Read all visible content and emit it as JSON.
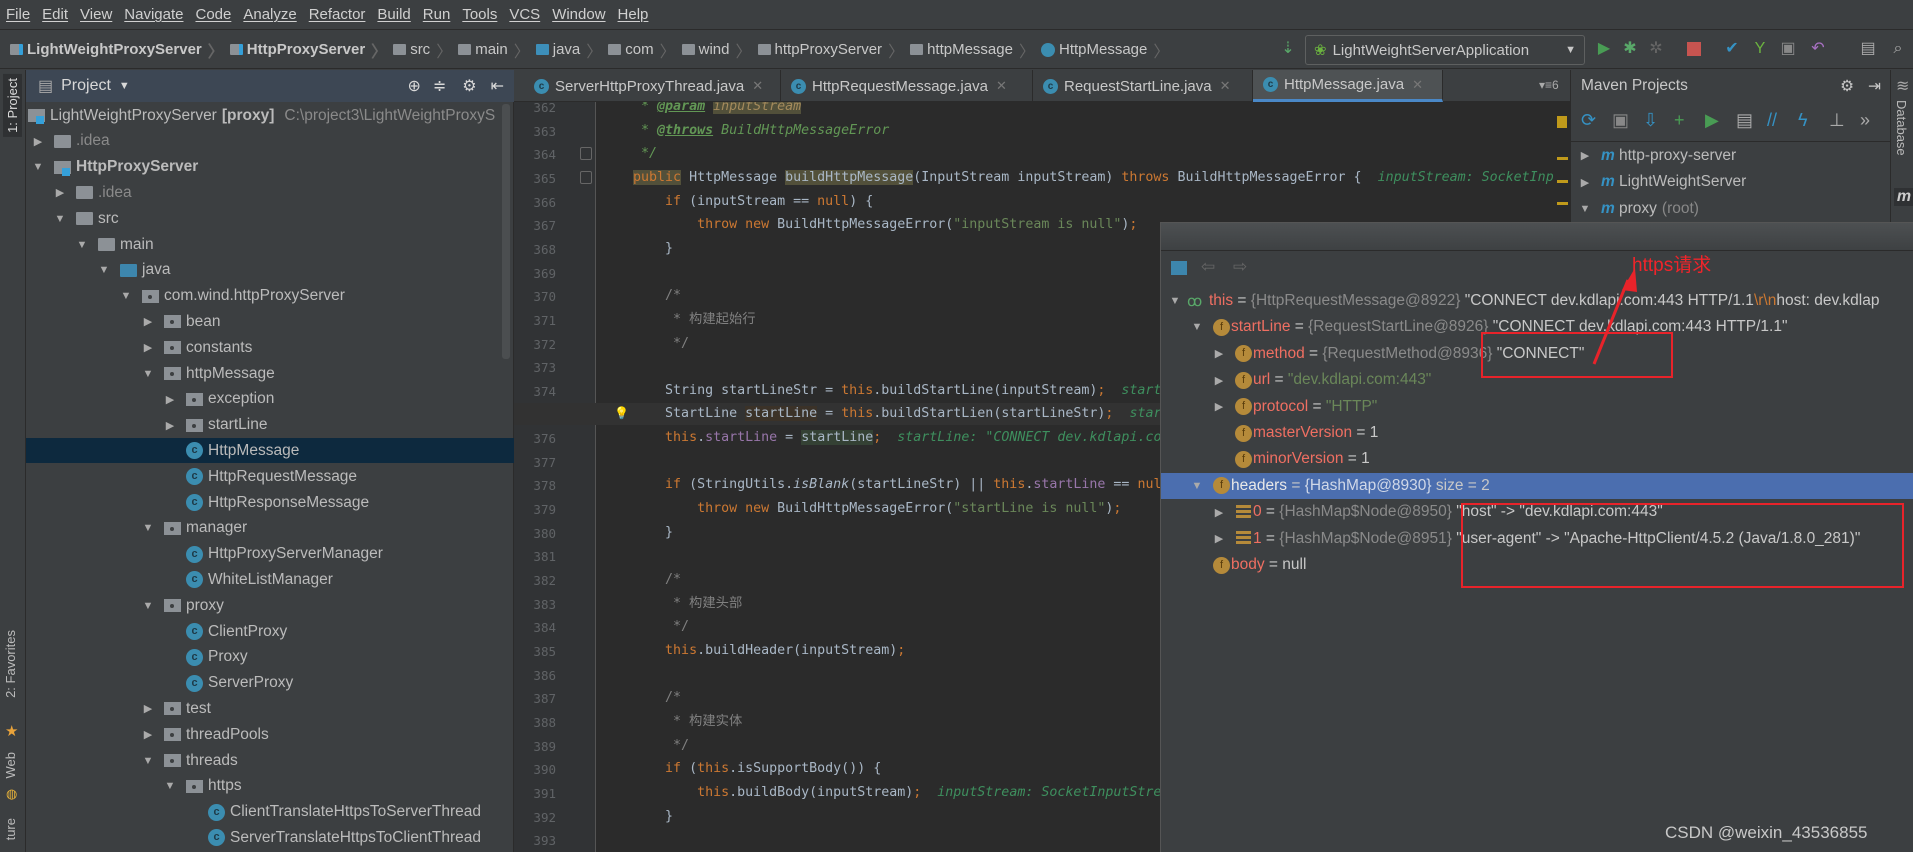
{
  "menu": [
    "File",
    "Edit",
    "View",
    "Navigate",
    "Code",
    "Analyze",
    "Refactor",
    "Build",
    "Run",
    "Tools",
    "VCS",
    "Window",
    "Help"
  ],
  "breadcrumbs": [
    {
      "label": "LightWeightProxyServer",
      "icon": "module-icon",
      "bold": true
    },
    {
      "label": "HttpProxyServer",
      "icon": "module-icon",
      "bold": true
    },
    {
      "label": "src",
      "icon": "folder-icon"
    },
    {
      "label": "main",
      "icon": "folder-icon"
    },
    {
      "label": "java",
      "icon": "source-folder-icon"
    },
    {
      "label": "com",
      "icon": "package-icon"
    },
    {
      "label": "wind",
      "icon": "package-icon"
    },
    {
      "label": "httpProxyServer",
      "icon": "package-icon"
    },
    {
      "label": "httpMessage",
      "icon": "package-icon"
    },
    {
      "label": "HttpMessage",
      "icon": "class-icon"
    }
  ],
  "run_config": "LightWeightServerApplication",
  "left_stripe": {
    "project": "1: Project",
    "favorites": "2: Favorites",
    "web": "Web",
    "structure": "ture"
  },
  "project_panel": {
    "title": "Project",
    "items": [
      {
        "depth": 0,
        "arrow": "",
        "icon": "module",
        "label": "LightWeightProxyServer",
        "suffix": "[proxy]",
        "path": "C:\\project3\\LightWeightProxyS"
      },
      {
        "depth": 0,
        "arrow": "right",
        "icon": "folder",
        "label": ".idea",
        "gray": true
      },
      {
        "depth": 0,
        "arrow": "down",
        "icon": "module",
        "label": "HttpProxyServer",
        "bold": true
      },
      {
        "depth": 1,
        "arrow": "right",
        "icon": "folder",
        "label": ".idea",
        "gray": true
      },
      {
        "depth": 1,
        "arrow": "down",
        "icon": "folder",
        "label": "src"
      },
      {
        "depth": 2,
        "arrow": "down",
        "icon": "folder",
        "label": "main"
      },
      {
        "depth": 3,
        "arrow": "down",
        "icon": "java",
        "label": "java"
      },
      {
        "depth": 4,
        "arrow": "down",
        "icon": "pkg",
        "label": "com.wind.httpProxyServer"
      },
      {
        "depth": 5,
        "arrow": "right",
        "icon": "pkg",
        "label": "bean"
      },
      {
        "depth": 5,
        "arrow": "right",
        "icon": "pkg",
        "label": "constants"
      },
      {
        "depth": 5,
        "arrow": "down",
        "icon": "pkg",
        "label": "httpMessage"
      },
      {
        "depth": 6,
        "arrow": "right",
        "icon": "pkg",
        "label": "exception"
      },
      {
        "depth": 6,
        "arrow": "right",
        "icon": "pkg",
        "label": "startLine"
      },
      {
        "depth": 6,
        "arrow": "",
        "icon": "cls",
        "label": "HttpMessage",
        "selected": true
      },
      {
        "depth": 6,
        "arrow": "",
        "icon": "cls",
        "label": "HttpRequestMessage"
      },
      {
        "depth": 6,
        "arrow": "",
        "icon": "cls",
        "label": "HttpResponseMessage"
      },
      {
        "depth": 5,
        "arrow": "down",
        "icon": "pkg",
        "label": "manager"
      },
      {
        "depth": 6,
        "arrow": "",
        "icon": "cls",
        "label": "HttpProxyServerManager"
      },
      {
        "depth": 6,
        "arrow": "",
        "icon": "cls",
        "label": "WhiteListManager"
      },
      {
        "depth": 5,
        "arrow": "down",
        "icon": "pkg",
        "label": "proxy"
      },
      {
        "depth": 6,
        "arrow": "",
        "icon": "cls",
        "label": "ClientProxy"
      },
      {
        "depth": 6,
        "arrow": "",
        "icon": "cls",
        "label": "Proxy"
      },
      {
        "depth": 6,
        "arrow": "",
        "icon": "cls",
        "label": "ServerProxy"
      },
      {
        "depth": 5,
        "arrow": "right",
        "icon": "pkg",
        "label": "test"
      },
      {
        "depth": 5,
        "arrow": "right",
        "icon": "pkg",
        "label": "threadPools"
      },
      {
        "depth": 5,
        "arrow": "down",
        "icon": "pkg",
        "label": "threads"
      },
      {
        "depth": 6,
        "arrow": "down",
        "icon": "pkg",
        "label": "https"
      },
      {
        "depth": 7,
        "arrow": "",
        "icon": "cls",
        "label": "ClientTranslateHttpsToServerThread"
      },
      {
        "depth": 7,
        "arrow": "",
        "icon": "cls",
        "label": "ServerTranslateHttpsToClientThread"
      }
    ]
  },
  "tabs": [
    {
      "label": "ServerHttpProxyThread.java"
    },
    {
      "label": "HttpRequestMessage.java"
    },
    {
      "label": "RequestStartLine.java"
    },
    {
      "label": "HttpMessage.java",
      "active": true
    }
  ],
  "tab_overflow_count": "6",
  "editor": {
    "current_line": 375,
    "lines": [
      {
        "n": "362",
        "t": [
          [
            "     * ",
            "cmi"
          ],
          [
            "@param",
            "tag"
          ],
          [
            " ",
            "cmi"
          ],
          [
            "inputStream",
            "mark"
          ]
        ]
      },
      {
        "n": "363",
        "t": [
          [
            "     * ",
            "cmi"
          ],
          [
            "@throws",
            "tag"
          ],
          [
            " BuildHttpMessageError",
            "cmi"
          ]
        ]
      },
      {
        "n": "364",
        "t": [
          [
            "     */",
            "cmi"
          ]
        ]
      },
      {
        "n": "365",
        "t": [
          [
            "    "
          ],
          [
            "public",
            "k hl"
          ],
          [
            " HttpMessage "
          ],
          [
            "buildHttpMessage",
            "hl"
          ],
          [
            "(InputStream inputStream) "
          ],
          [
            "throws",
            "k"
          ],
          [
            " BuildHttpMessageError {  "
          ],
          [
            "inputStream: SocketInp",
            "hint"
          ]
        ]
      },
      {
        "n": "366",
        "t": [
          [
            "        "
          ],
          [
            "if",
            "k"
          ],
          [
            " (inputStream == "
          ],
          [
            "null",
            "k"
          ],
          [
            ") {"
          ]
        ]
      },
      {
        "n": "367",
        "t": [
          [
            "            "
          ],
          [
            "throw new",
            "k"
          ],
          [
            " BuildHttpMessageError("
          ],
          [
            "\"inputStream is null\"",
            "s"
          ],
          [
            ")"
          ],
          [
            ";",
            "k"
          ]
        ]
      },
      {
        "n": "368",
        "t": [
          [
            "        }"
          ]
        ]
      },
      {
        "n": "369",
        "t": []
      },
      {
        "n": "370",
        "t": [
          [
            "        /*",
            "cm"
          ]
        ]
      },
      {
        "n": "371",
        "t": [
          [
            "         * 构建起始行",
            "cm"
          ]
        ]
      },
      {
        "n": "372",
        "t": [
          [
            "         */",
            "cm"
          ]
        ]
      },
      {
        "n": "373",
        "t": []
      },
      {
        "n": "374",
        "t": [
          [
            "        String startLineStr = "
          ],
          [
            "this",
            "k"
          ],
          [
            ".buildStartLine(inputStream)"
          ],
          [
            ";",
            "k"
          ],
          [
            "  "
          ],
          [
            "start",
            "hint"
          ]
        ]
      },
      {
        "n": "375",
        "t": [
          [
            "        StartLine "
          ],
          [
            "startLine",
            "hlv"
          ],
          [
            " = "
          ],
          [
            "this",
            "k"
          ],
          [
            ".buildStartLien(startLineStr)"
          ],
          [
            ";",
            "k"
          ],
          [
            "  "
          ],
          [
            "star",
            "hint"
          ]
        ]
      },
      {
        "n": "376",
        "t": [
          [
            "        "
          ],
          [
            "this",
            "k"
          ],
          [
            "."
          ],
          [
            "startLine",
            "f"
          ],
          [
            " = "
          ],
          [
            "startLine",
            "hlp"
          ],
          [
            ";",
            "k"
          ],
          [
            "  "
          ],
          [
            "startLine: \"CONNECT dev.kdlapi.co",
            "hint"
          ]
        ]
      },
      {
        "n": "377",
        "t": []
      },
      {
        "n": "378",
        "t": [
          [
            "        "
          ],
          [
            "if",
            "k"
          ],
          [
            " (StringUtils."
          ],
          [
            "isBlank",
            "it"
          ],
          [
            "(startLineStr) || "
          ],
          [
            "this",
            "k"
          ],
          [
            "."
          ],
          [
            "startLine",
            "f"
          ],
          [
            " == "
          ],
          [
            "nul",
            "k"
          ]
        ]
      },
      {
        "n": "379",
        "t": [
          [
            "            "
          ],
          [
            "throw new",
            "k"
          ],
          [
            " BuildHttpMessageError("
          ],
          [
            "\"startLine is null\"",
            "s"
          ],
          [
            ")"
          ],
          [
            ";",
            "k"
          ]
        ]
      },
      {
        "n": "380",
        "t": [
          [
            "        }"
          ]
        ]
      },
      {
        "n": "381",
        "t": []
      },
      {
        "n": "382",
        "t": [
          [
            "        /*",
            "cm"
          ]
        ]
      },
      {
        "n": "383",
        "t": [
          [
            "         * 构建头部",
            "cm"
          ]
        ]
      },
      {
        "n": "384",
        "t": [
          [
            "         */",
            "cm"
          ]
        ]
      },
      {
        "n": "385",
        "t": [
          [
            "        "
          ],
          [
            "this",
            "k"
          ],
          [
            ".buildHeader(inputStream)"
          ],
          [
            ";",
            "k"
          ]
        ]
      },
      {
        "n": "386",
        "t": []
      },
      {
        "n": "387",
        "t": [
          [
            "        /*",
            "cm"
          ]
        ]
      },
      {
        "n": "388",
        "t": [
          [
            "         * 构建实体",
            "cm"
          ]
        ]
      },
      {
        "n": "389",
        "t": [
          [
            "         */",
            "cm"
          ]
        ]
      },
      {
        "n": "390",
        "t": [
          [
            "        "
          ],
          [
            "if",
            "k"
          ],
          [
            " ("
          ],
          [
            "this",
            "k"
          ],
          [
            ".isSupportBody()) {"
          ]
        ]
      },
      {
        "n": "391",
        "t": [
          [
            "            "
          ],
          [
            "this",
            "k"
          ],
          [
            ".buildBody(inputStream)"
          ],
          [
            ";",
            "k"
          ],
          [
            "  "
          ],
          [
            "inputStream: SocketInputStre",
            "hint"
          ]
        ]
      },
      {
        "n": "392",
        "t": [
          [
            "        }"
          ]
        ]
      },
      {
        "n": "393",
        "t": []
      }
    ]
  },
  "maven": {
    "title": "Maven Projects",
    "toolbar": [
      "reimport-icon",
      "generate-sources-icon",
      "download-icon",
      "add-icon",
      "run-icon",
      "execute-goal-icon",
      "toggle-offline-icon",
      "skip-tests-icon",
      "show-dependencies-icon",
      "more-icon"
    ],
    "items": [
      {
        "label": "http-proxy-server",
        "arrow": "right"
      },
      {
        "label": "LightWeightServer",
        "arrow": "right"
      },
      {
        "label": "proxy",
        "suffix": "(root)",
        "arrow": "down"
      }
    ]
  },
  "right_stripe": {
    "database": "Database",
    "maven": "m"
  },
  "debug_popup": {
    "rows": [
      {
        "depth": 0,
        "arrow": "down",
        "icon": "watch",
        "t": [
          [
            "this",
            "dn"
          ],
          [
            " = ",
            "dv"
          ],
          [
            "{HttpRequestMessage@8922}",
            "dt"
          ],
          [
            " \"CONNECT dev.kdlapi.com:443 HTTP/1.1",
            "dv"
          ],
          [
            "\\r\\n",
            "de"
          ],
          [
            "host: dev.kdlap",
            "dv"
          ]
        ]
      },
      {
        "depth": 1,
        "arrow": "down",
        "icon": "f",
        "t": [
          [
            "startLine",
            "dn"
          ],
          [
            " = ",
            "dv"
          ],
          [
            "{RequestStartLine@8926}",
            "dt"
          ],
          [
            " \"CONNECT dev.kdlapi.com:443 HTTP/1.1\"",
            "dv"
          ]
        ]
      },
      {
        "depth": 2,
        "arrow": "right",
        "icon": "f",
        "t": [
          [
            "method",
            "dn"
          ],
          [
            " = ",
            "dv"
          ],
          [
            "{RequestMethod@8936}",
            "dt"
          ],
          [
            " \"CONNECT\"",
            "dv"
          ]
        ]
      },
      {
        "depth": 2,
        "arrow": "right",
        "icon": "f",
        "t": [
          [
            "url",
            "dn"
          ],
          [
            " = ",
            "dv"
          ],
          [
            "\"dev.kdlapi.com:443\"",
            "ds"
          ]
        ]
      },
      {
        "depth": 2,
        "arrow": "right",
        "icon": "f",
        "t": [
          [
            "protocol",
            "dn"
          ],
          [
            " = ",
            "dv"
          ],
          [
            "\"HTTP\"",
            "ds"
          ]
        ]
      },
      {
        "depth": 2,
        "arrow": "",
        "icon": "f",
        "t": [
          [
            "masterVersion",
            "dn"
          ],
          [
            " = 1",
            "dv"
          ]
        ]
      },
      {
        "depth": 2,
        "arrow": "",
        "icon": "f",
        "t": [
          [
            "minorVersion",
            "dn"
          ],
          [
            " = 1",
            "dv"
          ]
        ]
      },
      {
        "depth": 1,
        "arrow": "down",
        "icon": "f",
        "selected": true,
        "t": [
          [
            "headers",
            "dn"
          ],
          [
            " = ",
            "dv"
          ],
          [
            "{HashMap@8930}",
            "dt"
          ],
          [
            "  size = 2",
            "dv"
          ]
        ]
      },
      {
        "depth": 2,
        "arrow": "right",
        "icon": "entry",
        "t": [
          [
            "0",
            "dn"
          ],
          [
            " = ",
            "dv"
          ],
          [
            "{HashMap$Node@8950}",
            "dt"
          ],
          [
            " \"host\" -> \"dev.kdlapi.com:443\"",
            "dv"
          ]
        ]
      },
      {
        "depth": 2,
        "arrow": "right",
        "icon": "entry",
        "t": [
          [
            "1",
            "dn"
          ],
          [
            " = ",
            "dv"
          ],
          [
            "{HashMap$Node@8951}",
            "dt"
          ],
          [
            " \"user-agent\" -> \"Apache-HttpClient/4.5.2 (Java/1.8.0_281)\"",
            "dv"
          ]
        ]
      },
      {
        "depth": 1,
        "arrow": "",
        "icon": "f",
        "t": [
          [
            "body",
            "dn"
          ],
          [
            " = null",
            "dv"
          ]
        ]
      }
    ]
  },
  "annotation": {
    "label": "https请求",
    "color": "#e8232a"
  },
  "watermark": "CSDN @weixin_43536855",
  "colors": {
    "editor_bg": "#2b2b2b",
    "panel_bg": "#3c3f41",
    "selection": "#4b6eaf",
    "keyword": "#cc7832",
    "string": "#6a8759"
  }
}
